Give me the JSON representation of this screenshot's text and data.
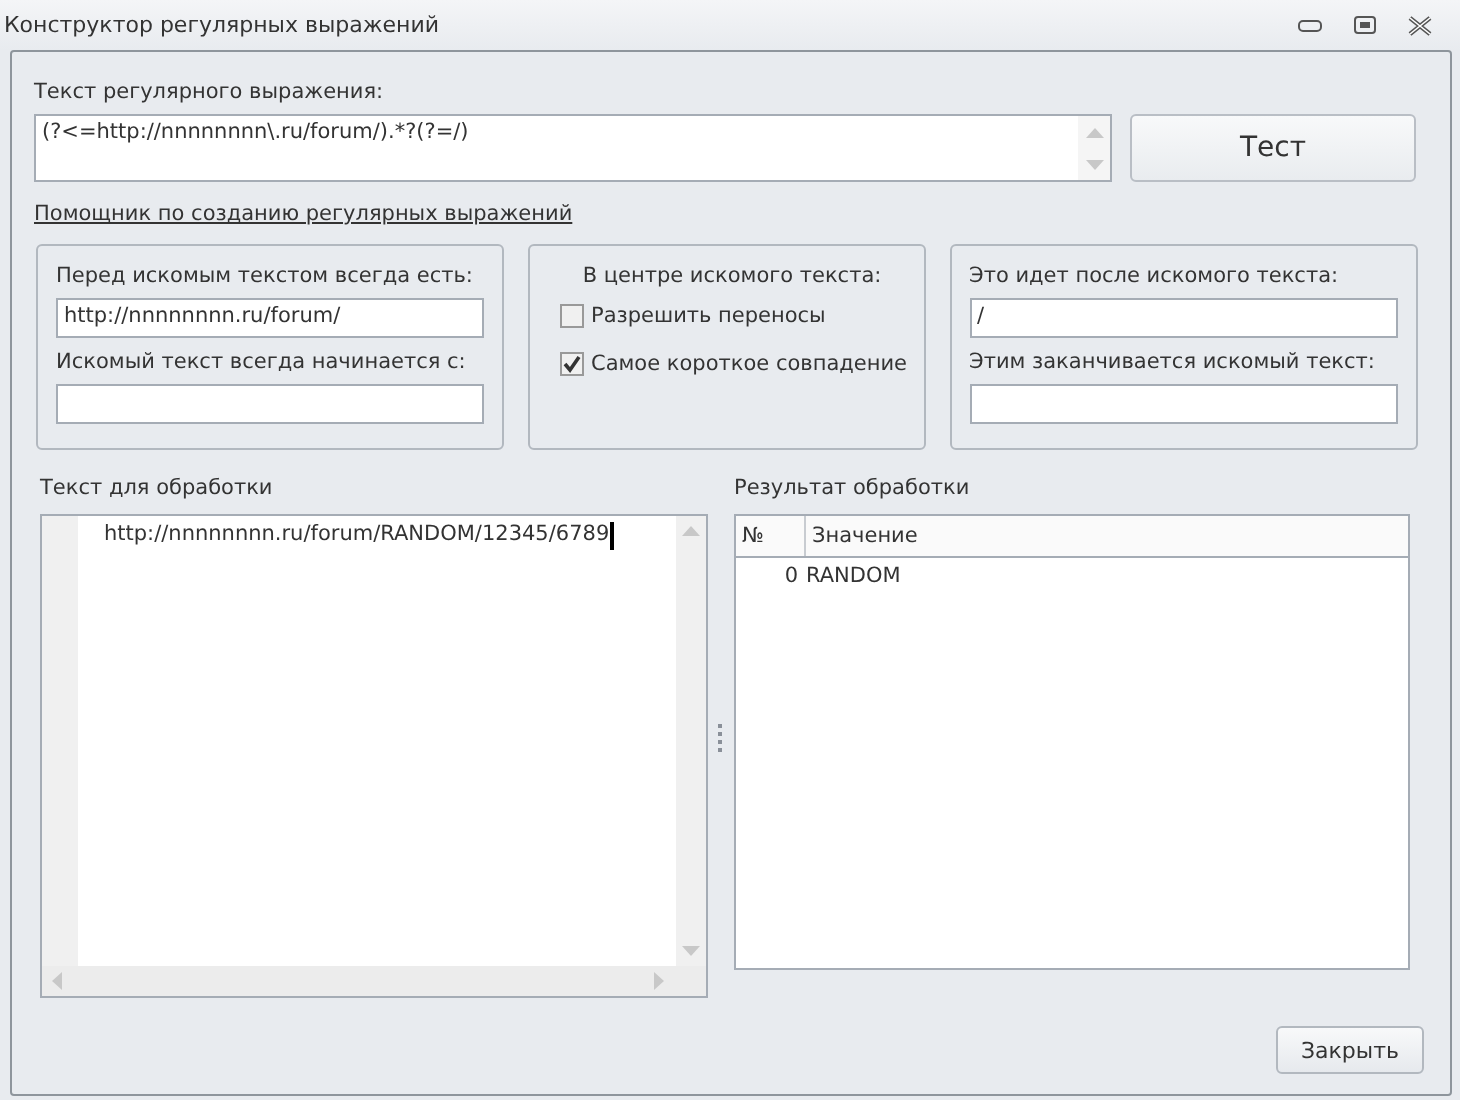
{
  "window": {
    "title": "Конструктор регулярных выражений"
  },
  "regex": {
    "label": "Текст регулярного выражения:",
    "value": "(?<=http://nnnnnnnn\\.ru/forum/).*?(?=/)"
  },
  "test_button": "Тест",
  "helper_link": "Помощник по созданию регулярных выражений",
  "before_group": {
    "fields": [
      {
        "label": "Перед искомым текстом всегда есть:",
        "value": "http://nnnnnnnn.ru/forum/"
      },
      {
        "label": "Искомый текст всегда начинается с:"
      }
    ]
  },
  "center_group": {
    "title": "В центре искомого текста:",
    "checkboxes": [
      {
        "label": "Разрешить переносы",
        "checked": false
      },
      {
        "label": "Самое короткое совпадение",
        "checked": true
      }
    ]
  },
  "after_group": {
    "fields": [
      {
        "label": "Это идет после искомого текста:",
        "value": "/"
      },
      {
        "label": "Этим заканчивается искомый текст:"
      }
    ]
  },
  "input_text": {
    "label": "Текст для обработки",
    "value": "http://nnnnnnnn.ru/forum/RANDOM/12345/6789"
  },
  "results": {
    "label": "Результат обработки",
    "columns": [
      "№",
      "Значение"
    ],
    "rows": [
      {
        "no": "0",
        "value": "RANDOM"
      }
    ]
  },
  "close_button": "Закрыть"
}
